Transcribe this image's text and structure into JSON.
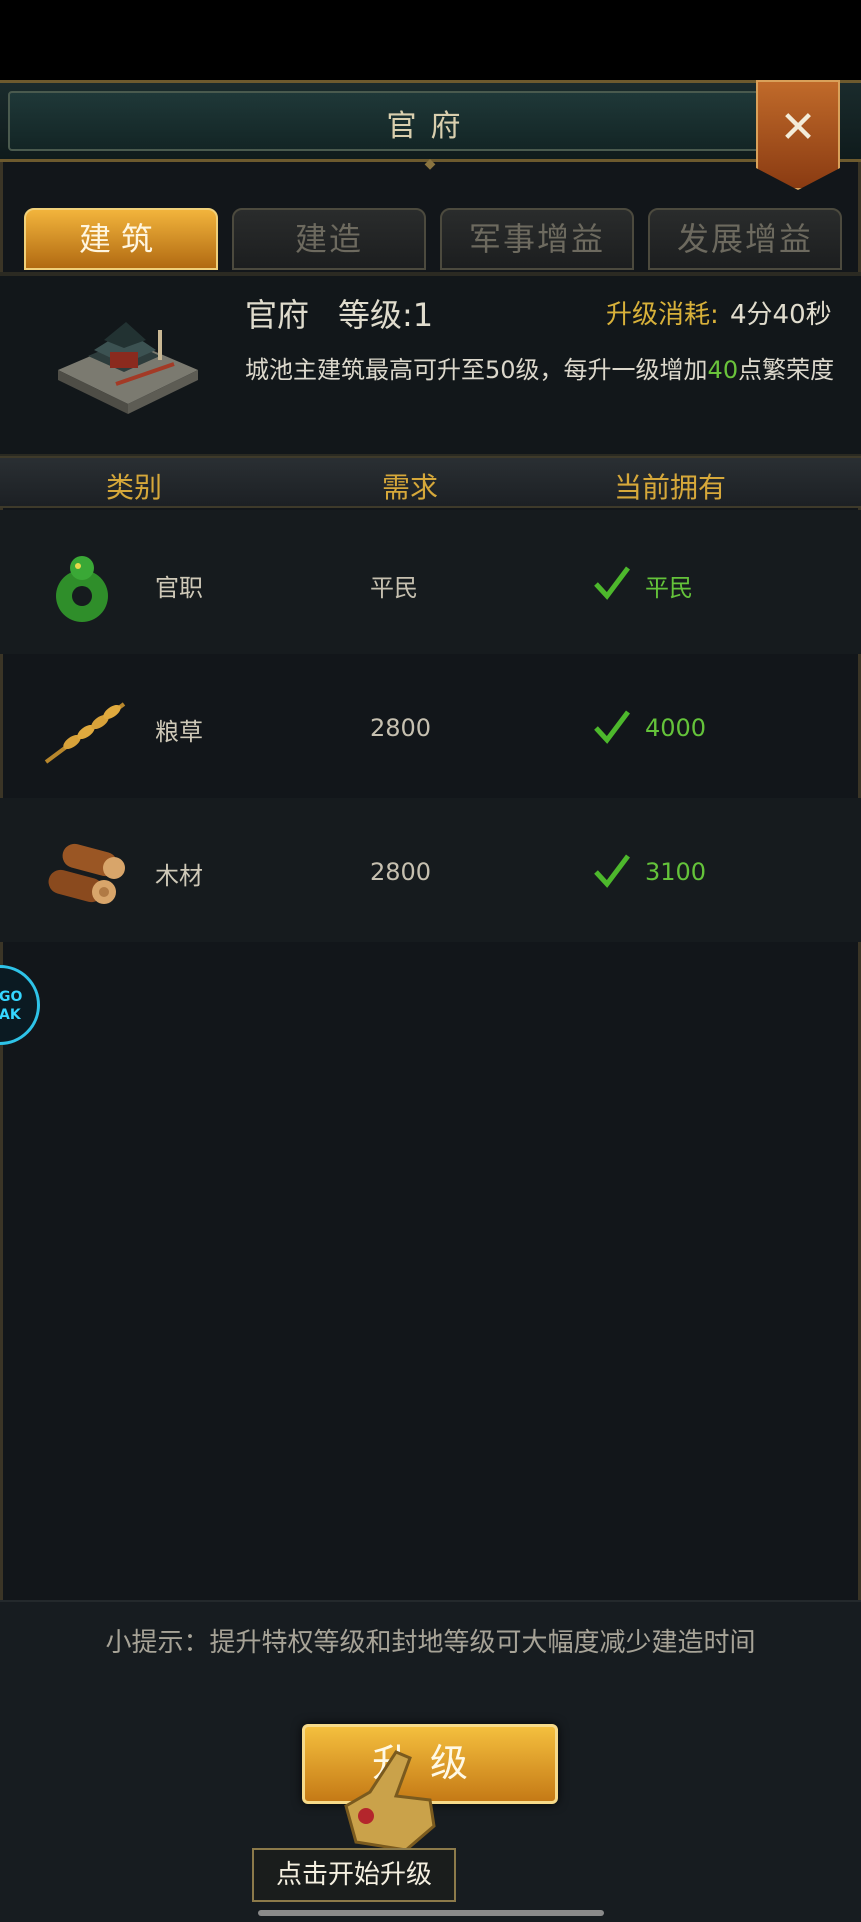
{
  "window": {
    "title": "官府",
    "close_icon": "close-icon"
  },
  "tabs": [
    {
      "label": "建筑",
      "active": true
    },
    {
      "label": "建造",
      "active": false
    },
    {
      "label": "军事增益",
      "active": false
    },
    {
      "label": "发展增益",
      "active": false
    }
  ],
  "building": {
    "name": "官府",
    "level_label": "等级:1",
    "cost_label": "升级消耗:",
    "cost_value": "4分40秒",
    "desc_part1": "城池主建筑最高可升至50级，每升一级增加",
    "desc_highlight": "40",
    "desc_part2": "点繁荣度",
    "icon": "palace-building-icon"
  },
  "table": {
    "headers": {
      "category": "类别",
      "requirement": "需求",
      "owned": "当前拥有"
    },
    "rows": [
      {
        "icon": "jade-ring-icon",
        "category": "官职",
        "requirement": "平民",
        "owned": "平民",
        "met": true
      },
      {
        "icon": "wheat-icon",
        "category": "粮草",
        "requirement": "2800",
        "owned": "4000",
        "met": true
      },
      {
        "icon": "wood-logs-icon",
        "category": "木材",
        "requirement": "2800",
        "owned": "3100",
        "met": true
      }
    ]
  },
  "side_button": {
    "text": "GO\nAK"
  },
  "footer": {
    "tip": "小提示：提升特权等级和封地等级可大幅度减少建造时间",
    "upgrade_label": "升级",
    "guide_tip": "点击开始升级"
  },
  "colors": {
    "accent_gold": "#d6a83a",
    "ok_green": "#64c33a",
    "tab_active": "#f2b43c"
  }
}
